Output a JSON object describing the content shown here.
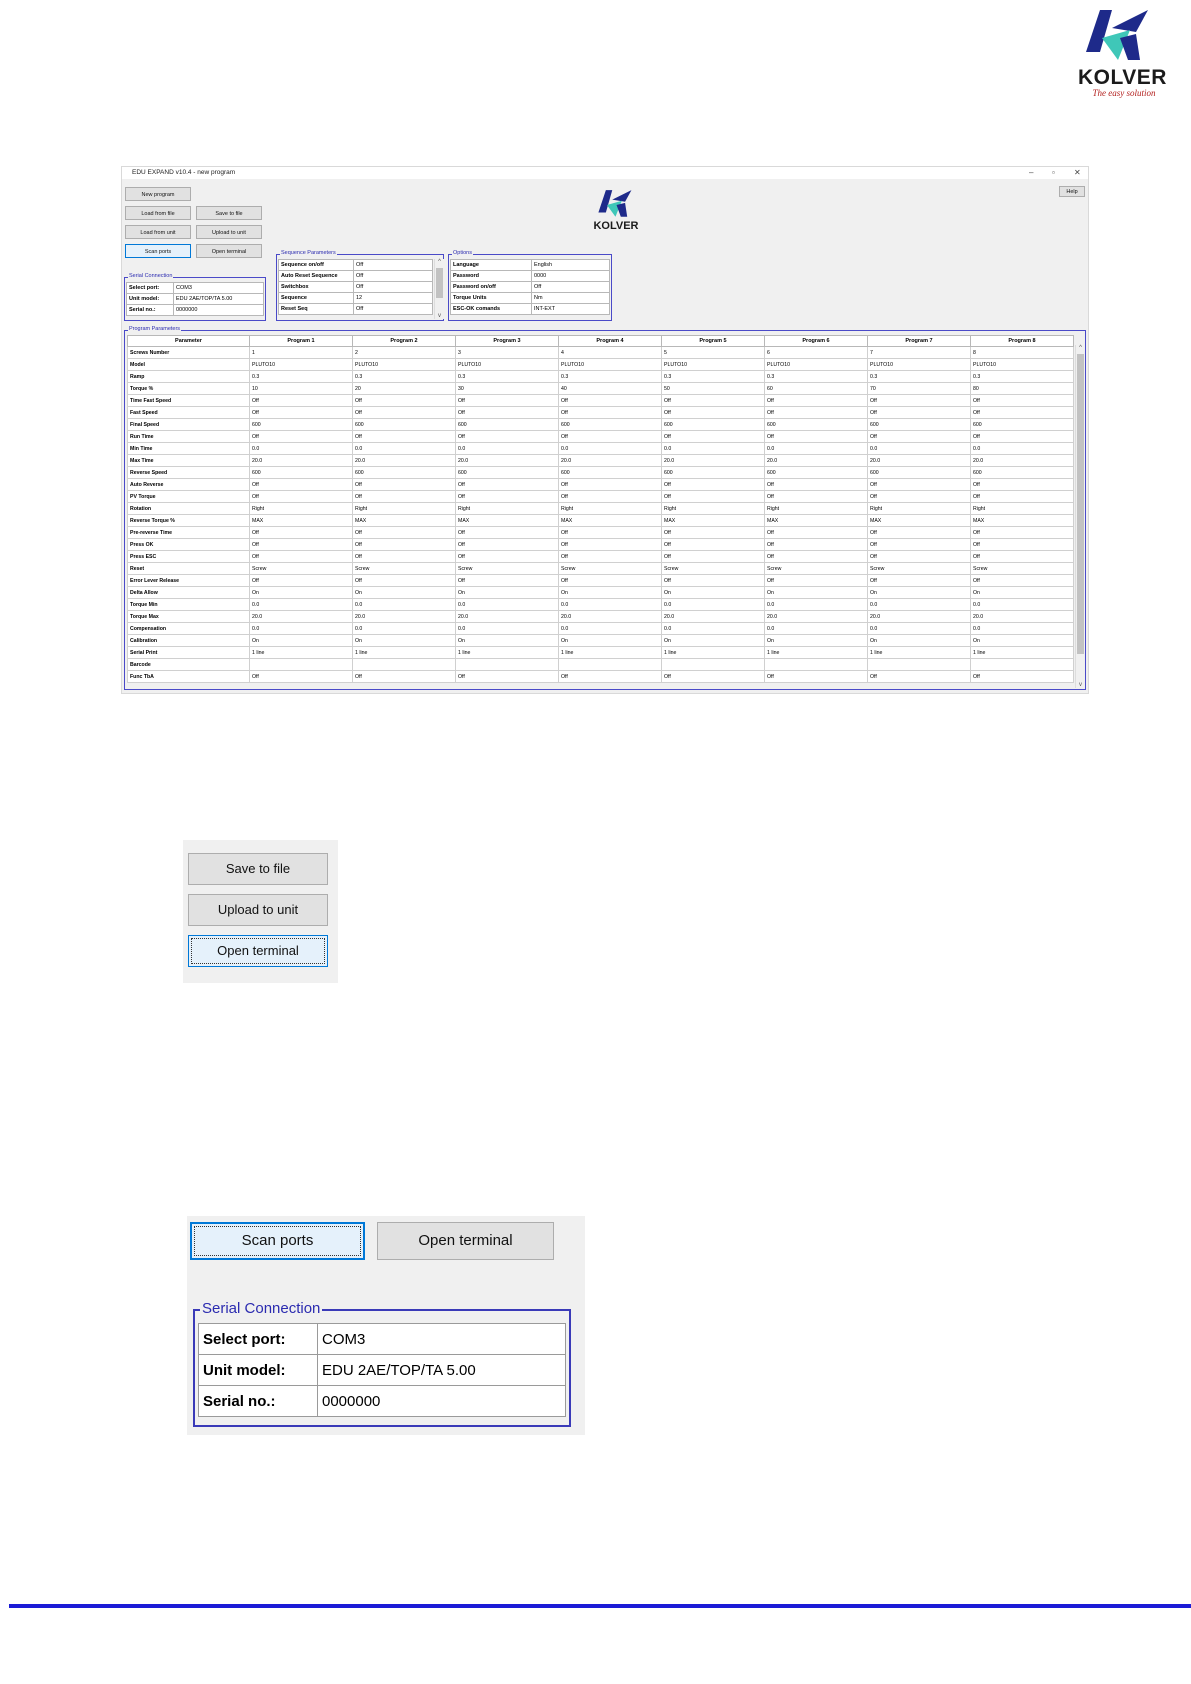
{
  "page_logo": {
    "brand": "KOLVER",
    "tagline": "The easy solution"
  },
  "window": {
    "title": "EDU EXPAND v10.4 - new program",
    "controls": {
      "minimize": "–",
      "restore": "▫",
      "close": "✕"
    },
    "buttons": {
      "new_program": "New program",
      "load_file": "Load from file",
      "save_file": "Save to file",
      "load_unit": "Load from unit",
      "upload_unit": "Upload to unit",
      "scan_ports": "Scan ports",
      "open_terminal": "Open terminal",
      "help": "Help"
    },
    "logo": "KOLVER",
    "serial": {
      "title": "Serial Connection",
      "rows": [
        {
          "k": "Select port:",
          "v": "COM3"
        },
        {
          "k": "Unit model:",
          "v": "EDU 2AE/TOP/TA 5.00"
        },
        {
          "k": "Serial no.:",
          "v": "0000000"
        }
      ]
    },
    "sequence": {
      "title": "Sequence Parameters",
      "rows": [
        {
          "k": "Sequence on/off",
          "v": "Off"
        },
        {
          "k": "Auto Reset Sequence",
          "v": "Off"
        },
        {
          "k": "Switchbox",
          "v": "Off"
        },
        {
          "k": "Sequence",
          "v": "12"
        },
        {
          "k": "Reset Seq",
          "v": "Off"
        }
      ]
    },
    "options": {
      "title": "Options",
      "rows": [
        {
          "k": "Language",
          "v": "English"
        },
        {
          "k": "Password",
          "v": "0000"
        },
        {
          "k": "Password on/off",
          "v": "Off"
        },
        {
          "k": "Torque Units",
          "v": "Nm"
        },
        {
          "k": "ESC-OK comands",
          "v": "INT-EXT"
        }
      ]
    },
    "program": {
      "title": "Program Parameters",
      "headers": [
        "Parameter",
        "Program 1",
        "Program 2",
        "Program 3",
        "Program 4",
        "Program 5",
        "Program 6",
        "Program 7",
        "Program 8"
      ],
      "rows": [
        [
          "Screws Number",
          "1",
          "2",
          "3",
          "4",
          "5",
          "6",
          "7",
          "8"
        ],
        [
          "Model",
          "PLUTO10",
          "PLUTO10",
          "PLUTO10",
          "PLUTO10",
          "PLUTO10",
          "PLUTO10",
          "PLUTO10",
          "PLUTO10"
        ],
        [
          "Ramp",
          "0.3",
          "0.3",
          "0.3",
          "0.3",
          "0.3",
          "0.3",
          "0.3",
          "0.3"
        ],
        [
          "Torque %",
          "10",
          "20",
          "30",
          "40",
          "50",
          "60",
          "70",
          "80"
        ],
        [
          "Time Fast Speed",
          "Off",
          "Off",
          "Off",
          "Off",
          "Off",
          "Off",
          "Off",
          "Off"
        ],
        [
          "Fast Speed",
          "Off",
          "Off",
          "Off",
          "Off",
          "Off",
          "Off",
          "Off",
          "Off"
        ],
        [
          "Final Speed",
          "600",
          "600",
          "600",
          "600",
          "600",
          "600",
          "600",
          "600"
        ],
        [
          "Run Time",
          "Off",
          "Off",
          "Off",
          "Off",
          "Off",
          "Off",
          "Off",
          "Off"
        ],
        [
          "Min Time",
          "0.0",
          "0.0",
          "0.0",
          "0.0",
          "0.0",
          "0.0",
          "0.0",
          "0.0"
        ],
        [
          "Max Time",
          "20.0",
          "20.0",
          "20.0",
          "20.0",
          "20.0",
          "20.0",
          "20.0",
          "20.0"
        ],
        [
          "Reverse Speed",
          "600",
          "600",
          "600",
          "600",
          "600",
          "600",
          "600",
          "600"
        ],
        [
          "Auto Reverse",
          "Off",
          "Off",
          "Off",
          "Off",
          "Off",
          "Off",
          "Off",
          "Off"
        ],
        [
          "PV Torque",
          "Off",
          "Off",
          "Off",
          "Off",
          "Off",
          "Off",
          "Off",
          "Off"
        ],
        [
          "Rotation",
          "Right",
          "Right",
          "Right",
          "Right",
          "Right",
          "Right",
          "Right",
          "Right"
        ],
        [
          "Reverse Torque %",
          "MAX",
          "MAX",
          "MAX",
          "MAX",
          "MAX",
          "MAX",
          "MAX",
          "MAX"
        ],
        [
          "Pre-reverse Time",
          "Off",
          "Off",
          "Off",
          "Off",
          "Off",
          "Off",
          "Off",
          "Off"
        ],
        [
          "Press OK",
          "Off",
          "Off",
          "Off",
          "Off",
          "Off",
          "Off",
          "Off",
          "Off"
        ],
        [
          "Press ESC",
          "Off",
          "Off",
          "Off",
          "Off",
          "Off",
          "Off",
          "Off",
          "Off"
        ],
        [
          "Reset",
          "Screw",
          "Screw",
          "Screw",
          "Screw",
          "Screw",
          "Screw",
          "Screw",
          "Screw"
        ],
        [
          "Error Lever Release",
          "Off",
          "Off",
          "Off",
          "Off",
          "Off",
          "Off",
          "Off",
          "Off"
        ],
        [
          "Delta Allow",
          "On",
          "On",
          "On",
          "On",
          "On",
          "On",
          "On",
          "On"
        ],
        [
          "Torque Min",
          "0.0",
          "0.0",
          "0.0",
          "0.0",
          "0.0",
          "0.0",
          "0.0",
          "0.0"
        ],
        [
          "Torque Max",
          "20.0",
          "20.0",
          "20.0",
          "20.0",
          "20.0",
          "20.0",
          "20.0",
          "20.0"
        ],
        [
          "Compensation",
          "0.0",
          "0.0",
          "0.0",
          "0.0",
          "0.0",
          "0.0",
          "0.0",
          "0.0"
        ],
        [
          "Calibration",
          "On",
          "On",
          "On",
          "On",
          "On",
          "On",
          "On",
          "On"
        ],
        [
          "Serial Print",
          "1 line",
          "1 line",
          "1 line",
          "1 line",
          "1 line",
          "1 line",
          "1 line",
          "1 line"
        ],
        [
          "Barcode",
          "",
          "",
          "",
          "",
          "",
          "",
          "",
          ""
        ],
        [
          "Func TbA",
          "Off",
          "Off",
          "Off",
          "Off",
          "Off",
          "Off",
          "Off",
          "Off"
        ]
      ]
    }
  },
  "zoom_buttons": {
    "save_file": "Save to file",
    "upload_unit": "Upload to unit",
    "open_terminal": "Open terminal"
  },
  "zoom_serial": {
    "scan_ports": "Scan ports",
    "open_terminal": "Open terminal",
    "title": "Serial Connection",
    "rows": [
      {
        "k": "Select port:",
        "v": "COM3"
      },
      {
        "k": "Unit model:",
        "v": "EDU 2AE/TOP/TA 5.00"
      },
      {
        "k": "Serial no.:",
        "v": "0000000"
      }
    ]
  },
  "colors": {
    "accent_blue": "#1b1bd6",
    "group_border": "#4a4ac8",
    "focus": "#0078d7",
    "logo_red": "#b3211f"
  }
}
